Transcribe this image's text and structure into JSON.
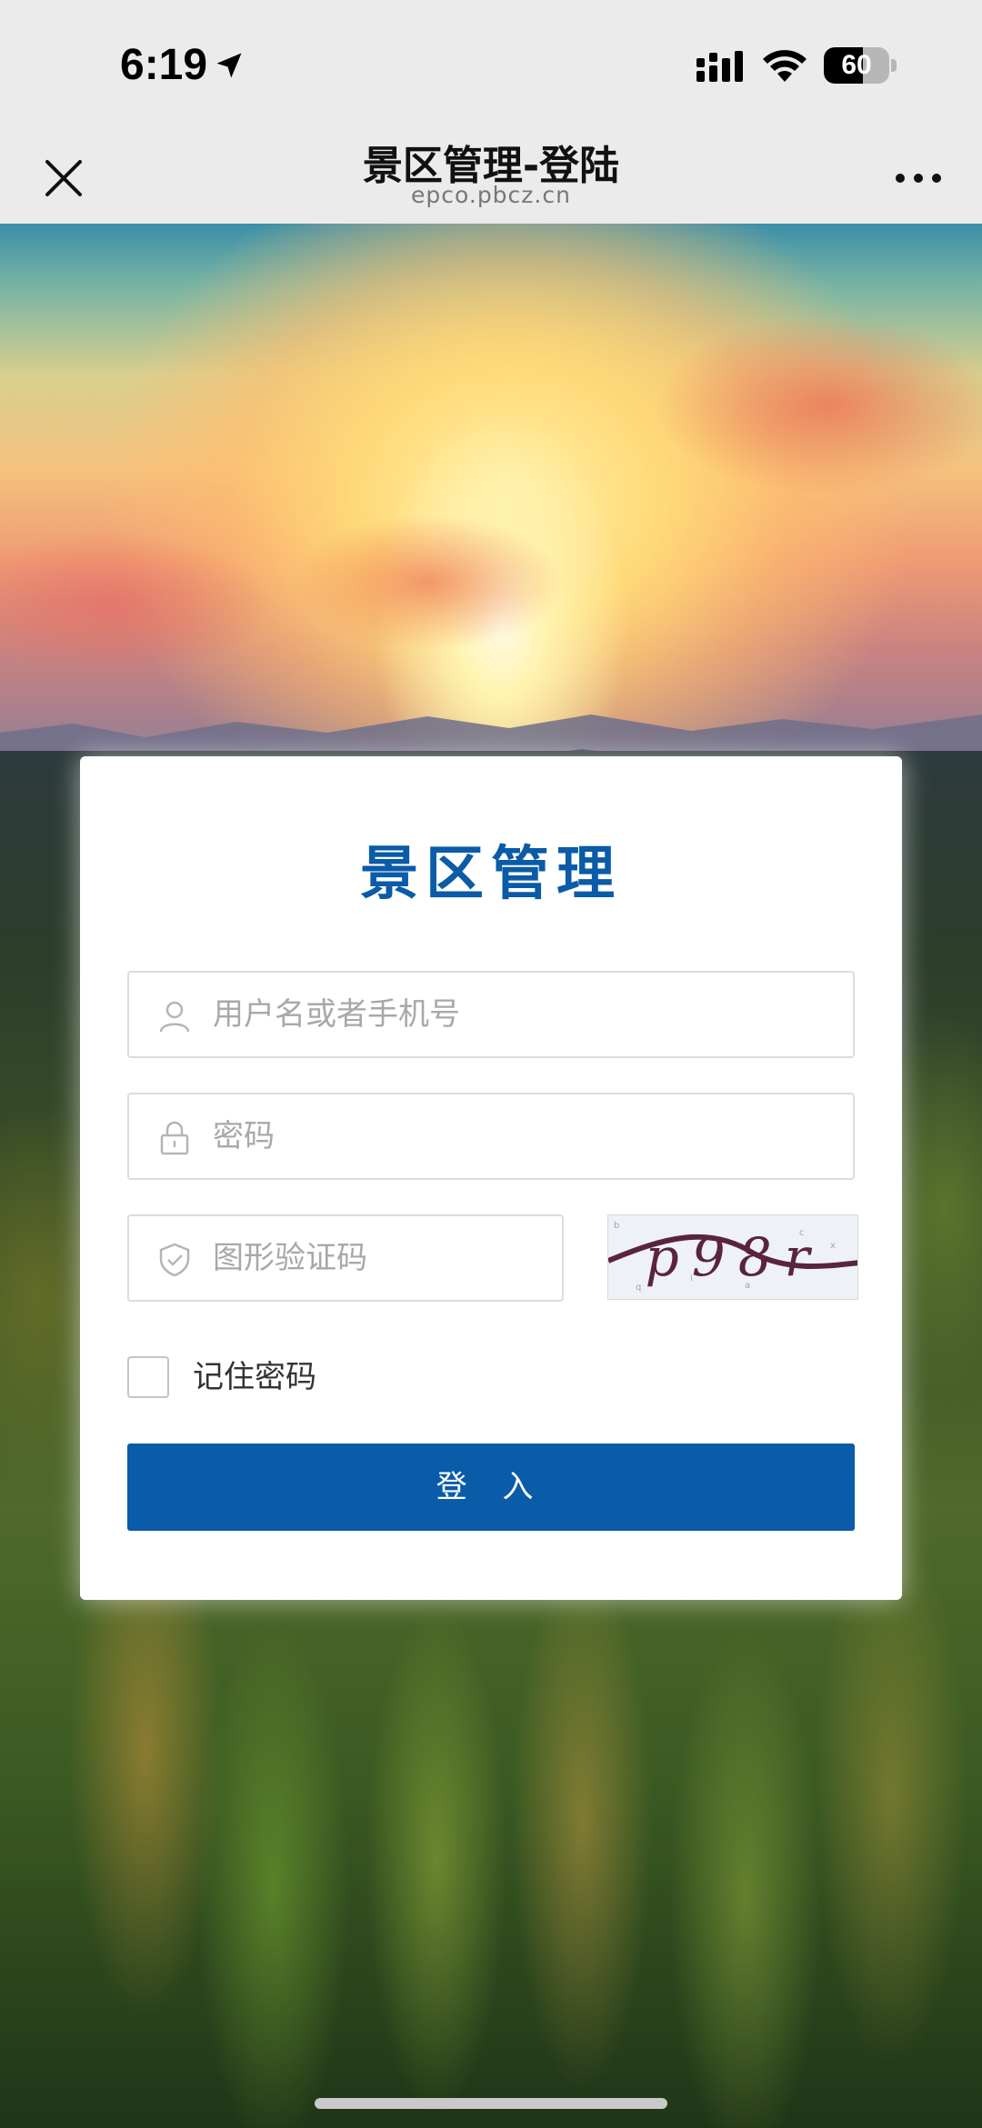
{
  "status_bar": {
    "time": "6:19",
    "battery": "60",
    "battery_level_percent": 60
  },
  "nav": {
    "title": "景区管理-登陆",
    "url": "epco.pbcz.cn"
  },
  "login": {
    "title": "景区管理",
    "username_placeholder": "用户名或者手机号",
    "password_placeholder": "密码",
    "captcha_placeholder": "图形验证码",
    "captcha_text": "p98r",
    "remember_label": "记住密码",
    "submit_label": "登 入"
  },
  "colors": {
    "brand": "#0a5ba8",
    "bar_background": "#ebebeb"
  }
}
